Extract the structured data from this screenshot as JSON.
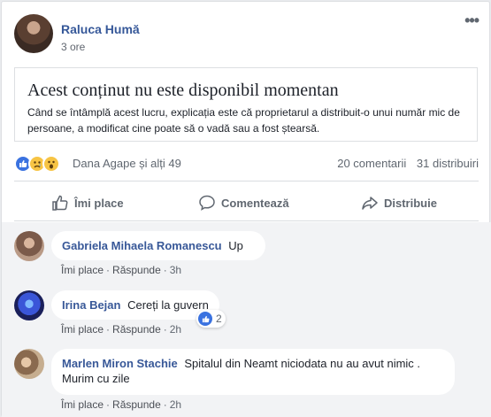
{
  "post": {
    "author": "Raluca Humă",
    "time": "3 ore",
    "more_label": "•••"
  },
  "unavailable": {
    "title": "Acest conținut nu este disponibil momentan",
    "body": "Când se întâmplă acest lucru, explicația este că proprietarul a distribuit-o unui număr mic de persoane, a modificat cine poate să o vadă sau a fost ștearsă."
  },
  "stats": {
    "reactions": [
      "like-icon",
      "sad-icon",
      "wow-icon"
    ],
    "reacted_by": "Dana Agape și alți 49",
    "comments": "20 comentarii",
    "shares": "31 distribuiri"
  },
  "actions": {
    "like": "Îmi place",
    "comment": "Comentează",
    "share": "Distribuie"
  },
  "comments": [
    {
      "name": "Gabriela Mihaela Romanescu",
      "text": "Up",
      "like": "Îmi place",
      "reply": "Răspunde",
      "time": "3h"
    },
    {
      "name": "Irina Bejan",
      "text": "Cereți la guvern",
      "like": "Îmi place",
      "reply": "Răspunde",
      "time": "2h",
      "reaction_count": "2"
    },
    {
      "name": "Marlen Miron Stachie",
      "text": "Spitalul din Neamt niciodata nu au avut nimic . Murim cu zile",
      "like": "Îmi place",
      "reply": "Răspunde",
      "time": "2h"
    }
  ],
  "colors": {
    "link": "#365899",
    "muted": "#606770",
    "like_blue": "#3a72e0",
    "comments_bg": "#f2f3f5"
  }
}
